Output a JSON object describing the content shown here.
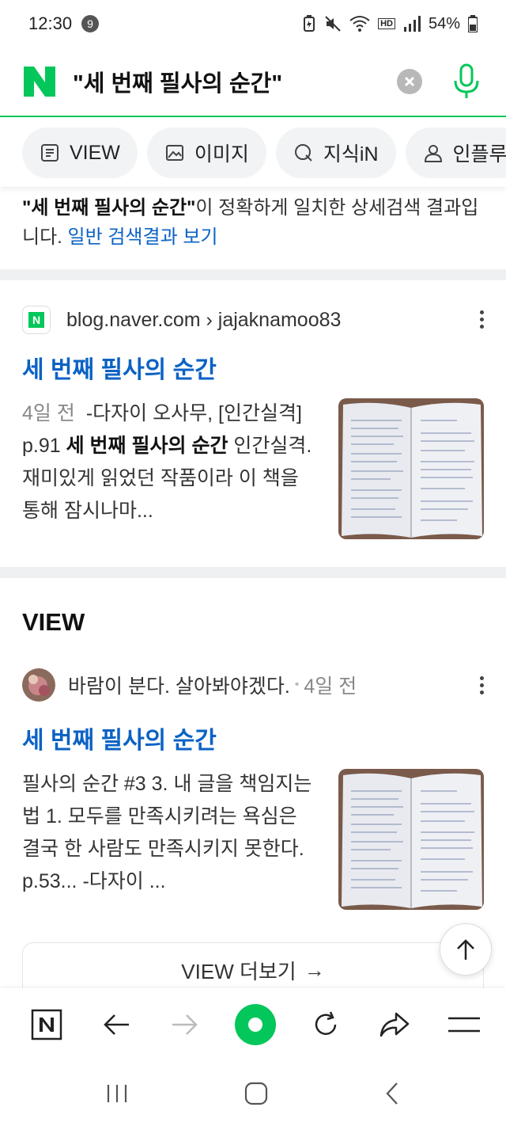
{
  "status": {
    "time": "12:30",
    "notification_count": "9",
    "hd_label": "HD",
    "battery": "54%"
  },
  "search": {
    "query": "\"세 번째 필사의 순간\"",
    "clear_icon": "close-icon",
    "mic_icon": "mic-icon"
  },
  "tabs": [
    {
      "label": "VIEW",
      "icon": "document-icon"
    },
    {
      "label": "이미지",
      "icon": "image-icon"
    },
    {
      "label": "지식iN",
      "icon": "q-icon"
    },
    {
      "label": "인플루",
      "icon": "person-icon"
    }
  ],
  "notice": {
    "query_bold": "\"세 번째 필사의 순간\"",
    "text": "이 정확하게 일치한 상세검색 결과입니다.",
    "link": "일반 검색결과 보기"
  },
  "result1": {
    "source": "blog.naver.com › jajaknamoo83",
    "title": "세 번째 필사의 순간",
    "date": "4일 전",
    "snippet_pre": "-다자이 오사무, [인간실격] p.91 ",
    "snippet_bold": "세 번째 필사의 순간",
    "snippet_post": " 인간실격. 재미있게 읽었던 작품이라 이 책을 통해 잠시나마..."
  },
  "view_section": {
    "heading": "VIEW",
    "author": "바람이 분다. 살아봐야겠다.",
    "date": "4일 전",
    "title": "세 번째 필사의 순간",
    "snippet": "필사의 순간 #3 3. 내 글을 책임지는 법 1. 모두를 만족시키려는 욕심은 결국 한 사람도 만족시키지 못한다. p.53... -다자이 ...",
    "more_label": "VIEW 더보기",
    "more_arrow": "→"
  },
  "colors": {
    "naver_green": "#03c75a",
    "link_blue": "#0b62c4",
    "separator": "#eef0f2"
  }
}
